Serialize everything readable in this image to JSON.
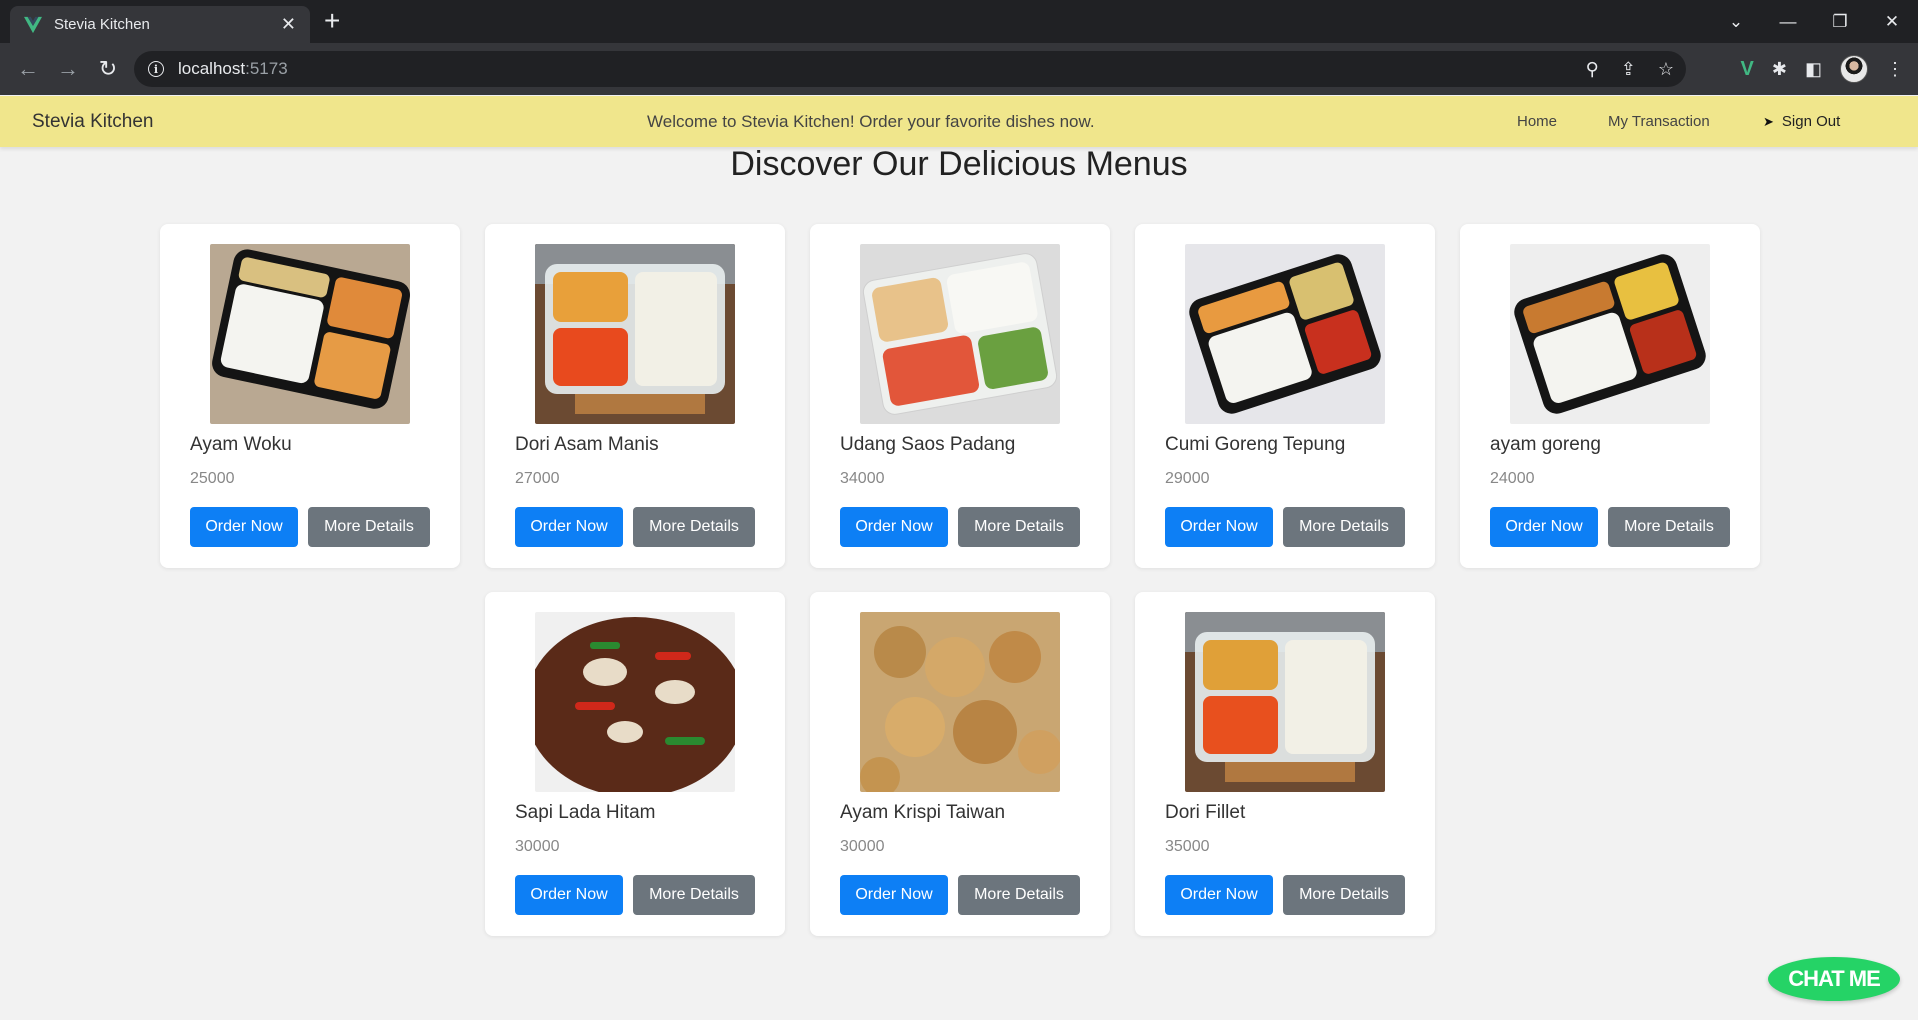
{
  "browser": {
    "tab_title": "Stevia Kitchen",
    "url_host": "localhost",
    "url_port": ":5173"
  },
  "nav": {
    "brand": "Stevia Kitchen",
    "welcome": "Welcome to Stevia Kitchen! Order your favorite dishes now.",
    "home": "Home",
    "transactions": "My Transaction",
    "signout": "Sign Out"
  },
  "page": {
    "heading": "Discover Our Delicious Menus"
  },
  "menus": [
    {
      "name": "Ayam Woku",
      "price": "25000",
      "order_label": "Order Now",
      "details_label": "More Details",
      "image": "bento-black-tray-rice-chicken"
    },
    {
      "name": "Dori Asam Manis",
      "price": "27000",
      "order_label": "Order Now",
      "details_label": "More Details",
      "image": "clear-box-sweet-sour-fish"
    },
    {
      "name": "Udang Saos Padang",
      "price": "34000",
      "order_label": "Order Now",
      "details_label": "More Details",
      "image": "clear-box-shrimp-rice"
    },
    {
      "name": "Cumi Goreng Tepung",
      "price": "29000",
      "order_label": "Order Now",
      "details_label": "More Details",
      "image": "black-tray-squid-rice"
    },
    {
      "name": "ayam goreng",
      "price": "24000",
      "order_label": "Order Now",
      "details_label": "More Details",
      "image": "black-tray-fried-chicken"
    },
    {
      "name": "Sapi Lada Hitam",
      "price": "30000",
      "order_label": "Order Now",
      "details_label": "More Details",
      "image": "black-pepper-beef-plate"
    },
    {
      "name": "Ayam Krispi Taiwan",
      "price": "30000",
      "order_label": "Order Now",
      "details_label": "More Details",
      "image": "taiwan-crispy-chicken"
    },
    {
      "name": "Dori Fillet",
      "price": "35000",
      "order_label": "Order Now",
      "details_label": "More Details",
      "image": "clear-box-dori-fillet"
    }
  ],
  "chat": {
    "label": "CHAT ME",
    "color": "#25d366"
  },
  "colors": {
    "navbar_bg": "#f0e68c",
    "primary": "#0d7ff5",
    "secondary": "#6c757d"
  }
}
